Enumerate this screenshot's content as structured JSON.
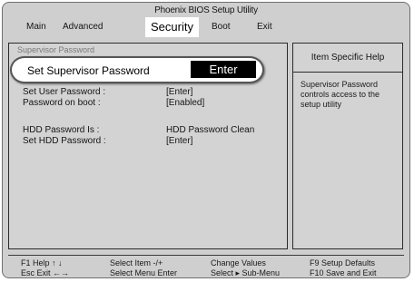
{
  "window": {
    "title": "Phoenix BIOS Setup Utility"
  },
  "menu": {
    "items": [
      {
        "label": "Main"
      },
      {
        "label": "Advanced"
      },
      {
        "label": "Security"
      },
      {
        "label": "Boot"
      },
      {
        "label": "Exit"
      }
    ],
    "active": "Security"
  },
  "settings": {
    "ghost_row": "Supervisor Password",
    "highlighted": {
      "label": "Set Supervisor Password",
      "value": "Enter"
    },
    "rows": [
      {
        "label": "Set User Password :",
        "value": "[Enter]"
      },
      {
        "label": "Password on boot :",
        "value": "[Enabled]"
      },
      {
        "label": "HDD Password Is :",
        "value": "HDD Password Clean"
      },
      {
        "label": "Set HDD Password :",
        "value": "[Enter]"
      }
    ]
  },
  "help": {
    "header": "Item Specific Help",
    "text_lines": [
      "Supervisor Password",
      "controls access to the",
      "setup utility"
    ]
  },
  "footer": {
    "col1": [
      "F1 Help  ↑ ↓",
      "Esc Exit  ←→"
    ],
    "col2": [
      "Select Item -/+",
      "Select Menu Enter"
    ],
    "col3": [
      "Change Values",
      "Select ▸ Sub-Menu"
    ],
    "col4": [
      "F9 Setup Defaults",
      "F10 Save and Exit"
    ]
  }
}
